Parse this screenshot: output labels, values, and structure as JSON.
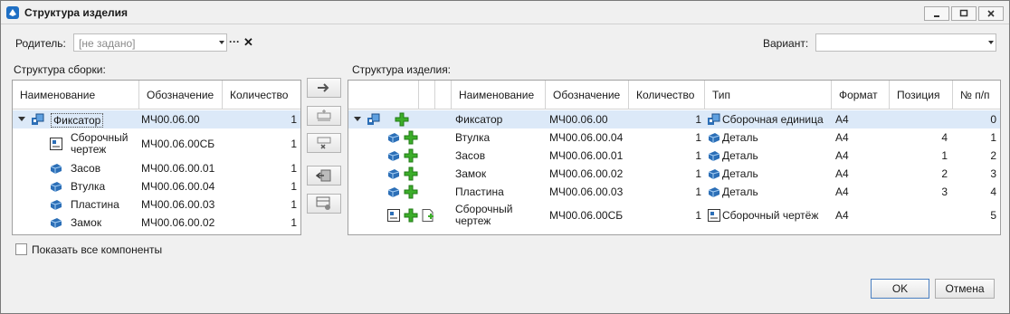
{
  "window": {
    "title": "Структура изделия"
  },
  "parent": {
    "label": "Родитель:",
    "value": "[не задано]",
    "ellipsis": "···",
    "clear": "✕"
  },
  "variant": {
    "label": "Вариант:",
    "value": ""
  },
  "assembly": {
    "title": "Структура сборки:",
    "columns": [
      "Наименование",
      "Обозначение",
      "Количество"
    ],
    "rows": [
      {
        "name": "Фиксатор",
        "code": "МЧ00.06.00",
        "qty": "1",
        "icon": "assembly-icon",
        "level": 0,
        "expanded": true,
        "selected": true
      },
      {
        "name": "Сборочный чертеж",
        "name_line1": "Сборочный",
        "name_line2": "чертеж",
        "code": "МЧ00.06.00СБ",
        "qty": "1",
        "icon": "drawing-icon",
        "level": 1
      },
      {
        "name": "Засов",
        "code": "МЧ00.06.00.01",
        "qty": "1",
        "icon": "part-icon",
        "level": 1
      },
      {
        "name": "Втулка",
        "code": "МЧ00.06.00.04",
        "qty": "1",
        "icon": "part-icon",
        "level": 1
      },
      {
        "name": "Пластина",
        "code": "МЧ00.06.00.03",
        "qty": "1",
        "icon": "part-icon",
        "level": 1
      },
      {
        "name": "Замок",
        "code": "МЧ00.06.00.02",
        "qty": "1",
        "icon": "part-icon",
        "level": 1
      }
    ]
  },
  "structure": {
    "title": "Структура изделия:",
    "columns": [
      "Наименование",
      "Обозначение",
      "Количество",
      "Тип",
      "Формат",
      "Позиция",
      "№ п/п"
    ],
    "rows": [
      {
        "name": "Фиксатор",
        "code": "МЧ00.06.00",
        "qty": "1",
        "type": "Сборочная единица",
        "format": "А4",
        "position": "",
        "num": "0",
        "icon": "assembly-icon"
      },
      {
        "name": "Втулка",
        "code": "МЧ00.06.00.04",
        "qty": "1",
        "type": "Деталь",
        "format": "А4",
        "position": "4",
        "num": "1",
        "icon": "part-icon"
      },
      {
        "name": "Засов",
        "code": "МЧ00.06.00.01",
        "qty": "1",
        "type": "Деталь",
        "format": "А4",
        "position": "1",
        "num": "2",
        "icon": "part-icon"
      },
      {
        "name": "Замок",
        "code": "МЧ00.06.00.02",
        "qty": "1",
        "type": "Деталь",
        "format": "А4",
        "position": "2",
        "num": "3",
        "icon": "part-icon"
      },
      {
        "name": "Пластина",
        "code": "МЧ00.06.00.03",
        "qty": "1",
        "type": "Деталь",
        "format": "А4",
        "position": "3",
        "num": "4",
        "icon": "part-icon"
      },
      {
        "name": "Сборочный чертеж",
        "name_line1": "Сборочный",
        "name_line2": "чертеж",
        "code": "МЧ00.06.00СБ",
        "qty": "1",
        "type": "Сборочный чертёж",
        "format": "А4",
        "position": "",
        "num": "5",
        "icon": "drawing-icon"
      }
    ]
  },
  "show_all": {
    "label": "Показать все компоненты",
    "checked": false
  },
  "buttons": {
    "ok": "OK",
    "cancel": "Отмена"
  },
  "colors": {
    "selection": "#dce9f8",
    "plus_green": "#3cae2a",
    "part_blue": "#2c6fb7"
  }
}
